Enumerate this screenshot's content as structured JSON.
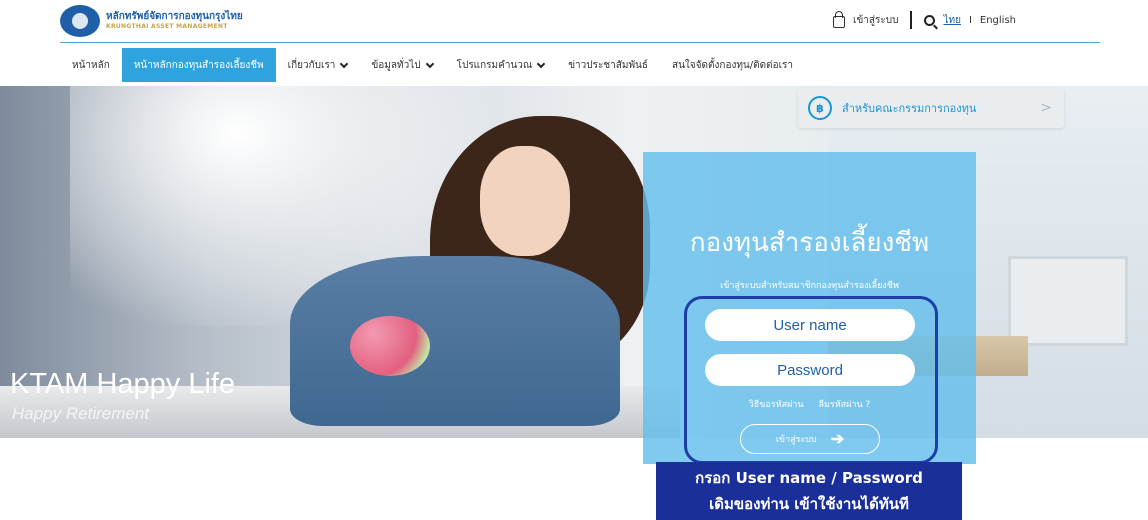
{
  "brand": {
    "name_th": "หลักทรัพย์จัดการกองทุนกรุงไทย",
    "name_en": "KRUNGTHAI ASSET MANAGEMENT",
    "color": "#1f5fa8",
    "accent": "#2ea3dd"
  },
  "top_right": {
    "login_label": "เข้าสู่ระบบ",
    "lang_th": "ไทย",
    "lang_sep": "I",
    "lang_en": "English"
  },
  "nav": {
    "items": [
      {
        "label": "หน้าหลัก"
      },
      {
        "label": "หน้าหลักกองทุนสำรองเลี้ยงชีพ",
        "active": true
      },
      {
        "label": "เกี่ยวกับเรา",
        "dropdown": true
      },
      {
        "label": "ข้อมูลทั่วไป",
        "dropdown": true
      },
      {
        "label": "โปรแกรมคำนวณ",
        "dropdown": true
      },
      {
        "label": "ข่าวประชาสัมพันธ์"
      },
      {
        "label": "สนใจจัดตั้งกองทุน/ติดต่อเรา"
      }
    ]
  },
  "hero": {
    "title": "KTAM Happy Life",
    "subtitle": "Happy Retirement"
  },
  "committee": {
    "icon": "baht-icon",
    "icon_glyph": "฿",
    "label": "สำหรับคณะกรรมการกองทุน",
    "arrow": ">"
  },
  "login": {
    "title": "กองทุนสำรองเลี้ยงชีพ",
    "subtitle": "เข้าสู่ระบบสำหรับสมาชิกกองทุนสำรองเลี้ยงชีพ",
    "username_placeholder": "User name",
    "password_placeholder": "Password",
    "request_password": "วิธีขอรหัสผ่าน",
    "forgot_password": "ลืมรหัสผ่าน ?",
    "submit_label": "เข้าสู่ระบบ",
    "submit_icon": "➔"
  },
  "callout": {
    "line1": "กรอก User name / Password",
    "line2": "เดิมของท่าน เข้าใช้งานได้ทันที",
    "color": "#1b2f9a"
  }
}
